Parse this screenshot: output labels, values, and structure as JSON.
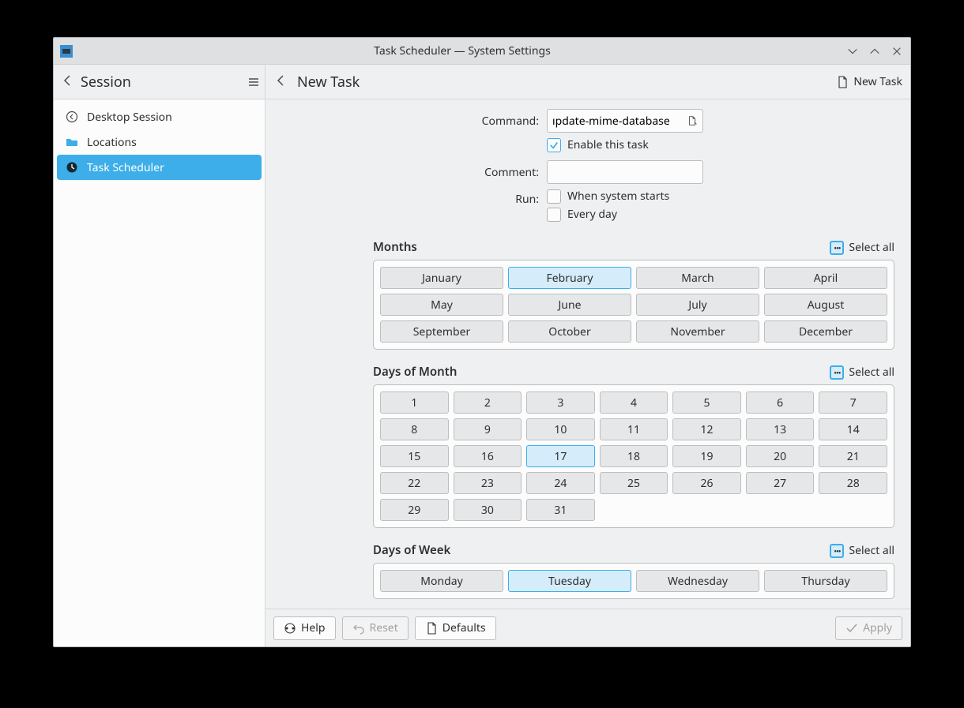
{
  "window": {
    "title": "Task Scheduler — System Settings"
  },
  "toolbar": {
    "session_label": "Session",
    "page_title": "New Task",
    "new_task_label": "New Task"
  },
  "sidebar": {
    "items": [
      {
        "label": "Desktop Session",
        "icon": "previous-session-icon",
        "selected": false
      },
      {
        "label": "Locations",
        "icon": "folder-icon",
        "selected": false
      },
      {
        "label": "Task Scheduler",
        "icon": "clock-icon",
        "selected": true
      }
    ]
  },
  "form": {
    "command_label": "Command:",
    "command_value": "ıpdate-mime-database",
    "enable_checkbox_label": "Enable this task",
    "enable_checked": true,
    "comment_label": "Comment:",
    "comment_value": "",
    "run_label": "Run:",
    "run_options": [
      {
        "label": "When system starts",
        "checked": false
      },
      {
        "label": "Every day",
        "checked": false
      }
    ]
  },
  "sections": {
    "months": {
      "title": "Months",
      "select_all_label": "Select all",
      "items": [
        {
          "label": "January",
          "selected": false
        },
        {
          "label": "February",
          "selected": true
        },
        {
          "label": "March",
          "selected": false
        },
        {
          "label": "April",
          "selected": false
        },
        {
          "label": "May",
          "selected": false
        },
        {
          "label": "June",
          "selected": false
        },
        {
          "label": "July",
          "selected": false
        },
        {
          "label": "August",
          "selected": false
        },
        {
          "label": "September",
          "selected": false
        },
        {
          "label": "October",
          "selected": false
        },
        {
          "label": "November",
          "selected": false
        },
        {
          "label": "December",
          "selected": false
        }
      ]
    },
    "days_of_month": {
      "title": "Days of Month",
      "select_all_label": "Select all",
      "items": [
        {
          "label": "1",
          "selected": false
        },
        {
          "label": "2",
          "selected": false
        },
        {
          "label": "3",
          "selected": false
        },
        {
          "label": "4",
          "selected": false
        },
        {
          "label": "5",
          "selected": false
        },
        {
          "label": "6",
          "selected": false
        },
        {
          "label": "7",
          "selected": false
        },
        {
          "label": "8",
          "selected": false
        },
        {
          "label": "9",
          "selected": false
        },
        {
          "label": "10",
          "selected": false
        },
        {
          "label": "11",
          "selected": false
        },
        {
          "label": "12",
          "selected": false
        },
        {
          "label": "13",
          "selected": false
        },
        {
          "label": "14",
          "selected": false
        },
        {
          "label": "15",
          "selected": false
        },
        {
          "label": "16",
          "selected": false
        },
        {
          "label": "17",
          "selected": true
        },
        {
          "label": "18",
          "selected": false
        },
        {
          "label": "19",
          "selected": false
        },
        {
          "label": "20",
          "selected": false
        },
        {
          "label": "21",
          "selected": false
        },
        {
          "label": "22",
          "selected": false
        },
        {
          "label": "23",
          "selected": false
        },
        {
          "label": "24",
          "selected": false
        },
        {
          "label": "25",
          "selected": false
        },
        {
          "label": "26",
          "selected": false
        },
        {
          "label": "27",
          "selected": false
        },
        {
          "label": "28",
          "selected": false
        },
        {
          "label": "29",
          "selected": false
        },
        {
          "label": "30",
          "selected": false
        },
        {
          "label": "31",
          "selected": false
        }
      ]
    },
    "days_of_week": {
      "title": "Days of Week",
      "select_all_label": "Select all",
      "items": [
        {
          "label": "Monday",
          "selected": false
        },
        {
          "label": "Tuesday",
          "selected": true
        },
        {
          "label": "Wednesday",
          "selected": false
        },
        {
          "label": "Thursday",
          "selected": false
        }
      ]
    }
  },
  "footer": {
    "help_label": "Help",
    "reset_label": "Reset",
    "defaults_label": "Defaults",
    "apply_label": "Apply",
    "reset_disabled": true,
    "apply_disabled": true
  },
  "colors": {
    "accent": "#3daee9",
    "bg": "#eff0f1",
    "panel": "#fcfcfc"
  }
}
